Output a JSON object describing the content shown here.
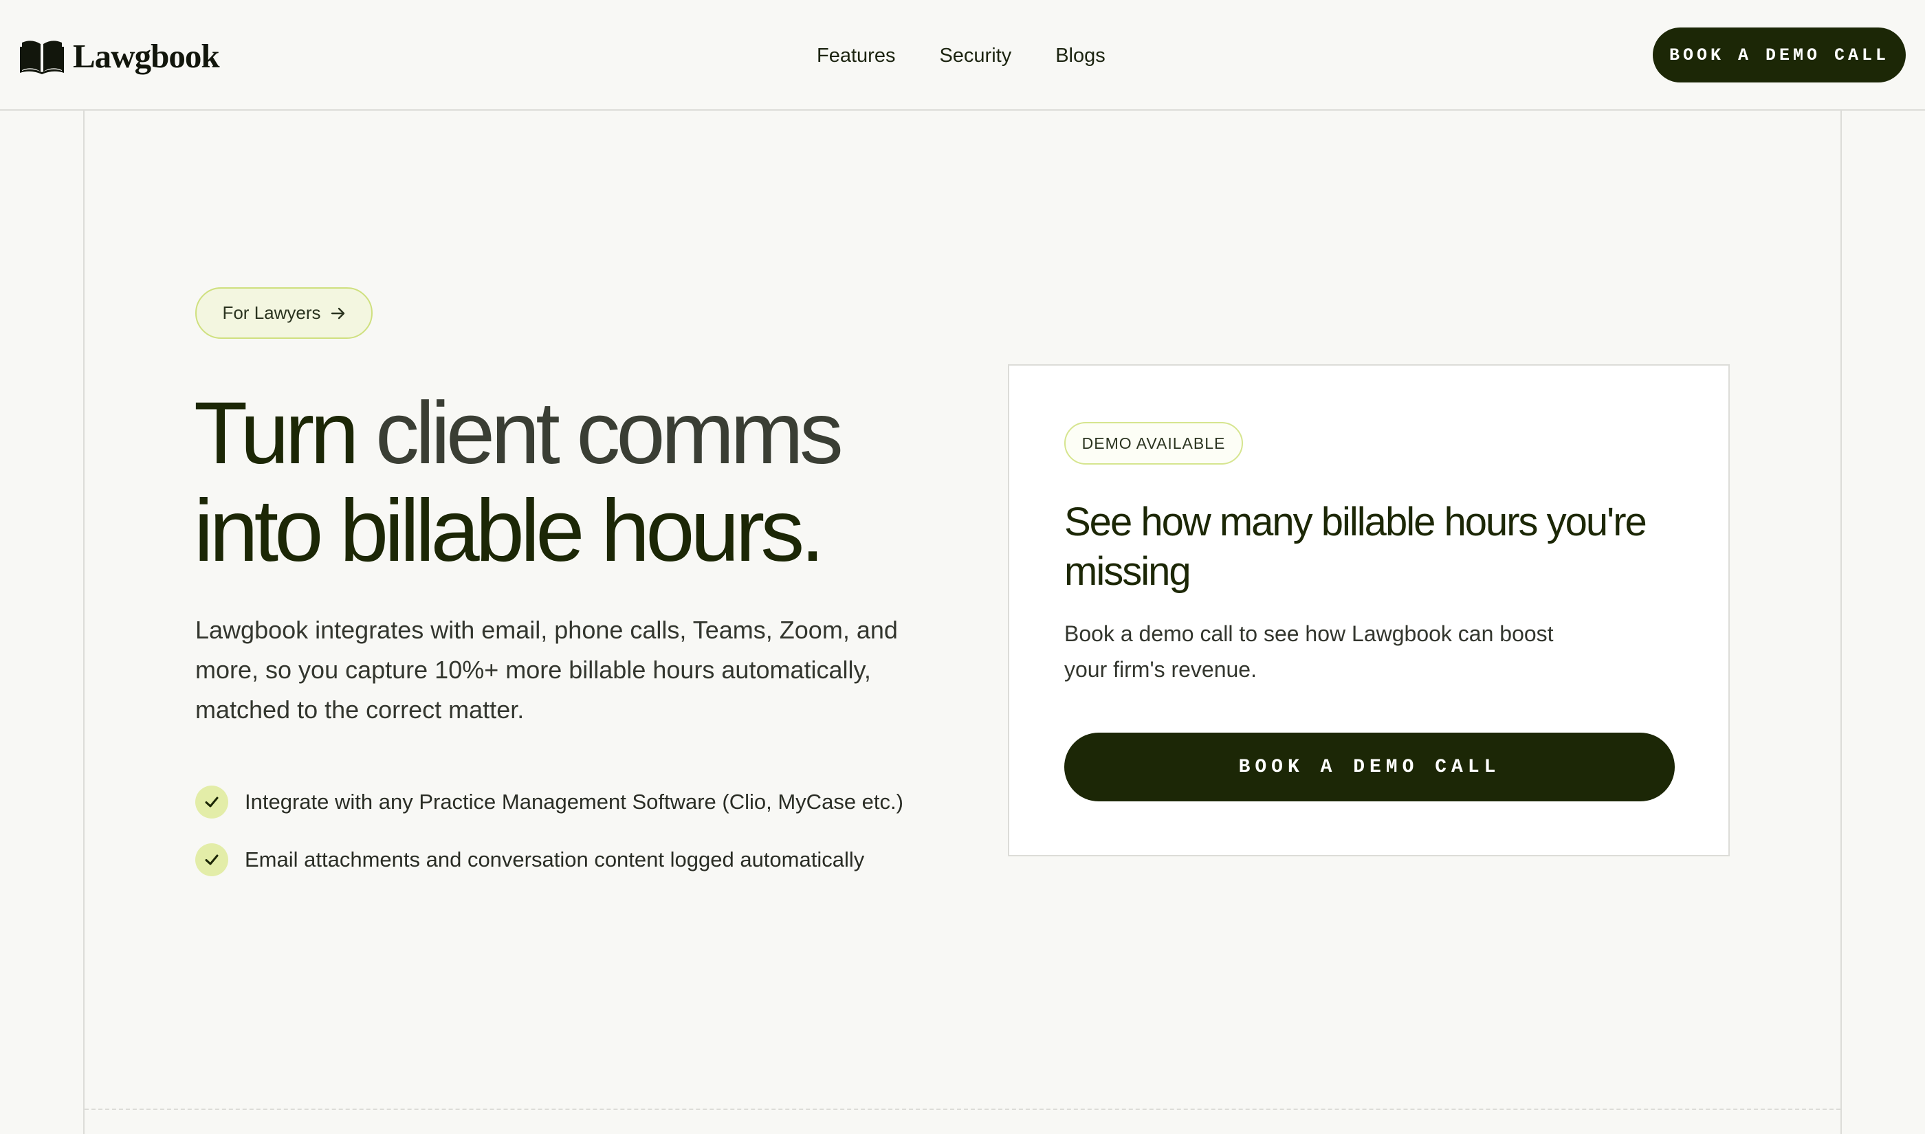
{
  "header": {
    "logo_text": "Lawgbook",
    "logo_icon": "open-book-icon",
    "nav": [
      {
        "label": "Features"
      },
      {
        "label": "Security"
      },
      {
        "label": "Blogs"
      }
    ],
    "cta_label": "BOOK A DEMO CALL"
  },
  "hero": {
    "pill_label": "For Lawyers",
    "pill_icon": "arrow-right-icon",
    "title_line1_strong": "Turn",
    "title_line1_muted": " client comms",
    "title_line2": "into billable hours.",
    "description": "Lawgbook integrates with email, phone calls, Teams, Zoom, and more, so you capture 10%+ more billable hours automatically, matched to the correct matter.",
    "features": [
      {
        "text": "Integrate with any Practice Management Software (Clio, MyCase etc.)",
        "icon": "check-icon"
      },
      {
        "text": "Email attachments and conversation content logged automatically",
        "icon": "check-icon"
      }
    ]
  },
  "demo_card": {
    "badge": "DEMO AVAILABLE",
    "title": "See how many billable hours you're missing",
    "description": "Book a demo call to see how Lawgbook can boost your firm's revenue.",
    "cta_label": "BOOK A DEMO CALL"
  },
  "colors": {
    "background": "#f8f8f5",
    "primary_dark": "#1c2706",
    "accent_lime": "#e3eda8",
    "accent_border": "#cfe07f"
  }
}
